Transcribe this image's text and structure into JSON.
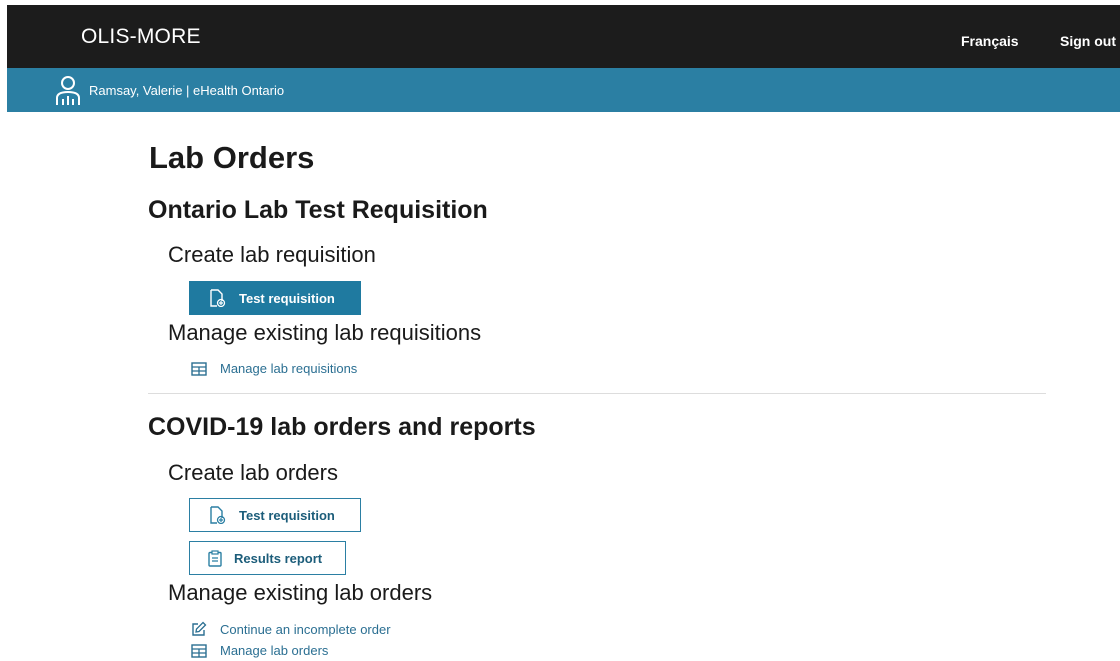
{
  "header": {
    "app_title": "OLIS-MORE",
    "language_link": "Français",
    "signout_link": "Sign out"
  },
  "user_bar": {
    "user_text": "Ramsay, Valerie | eHealth Ontario"
  },
  "page": {
    "title": "Lab Orders"
  },
  "section_ontario": {
    "heading": "Ontario Lab Test Requisition",
    "create_heading": "Create lab requisition",
    "test_requisition_button": "Test requisition",
    "manage_heading": "Manage existing lab requisitions",
    "manage_link": "Manage lab requisitions"
  },
  "section_covid": {
    "heading": "COVID-19 lab orders and reports",
    "create_heading": "Create lab orders",
    "test_requisition_button": "Test requisition",
    "results_report_button": "Results report",
    "manage_heading": "Manage existing lab orders",
    "continue_link": "Continue an incomplete order",
    "manage_link": "Manage lab orders"
  },
  "icons": {
    "user": "user-icon",
    "document_add": "document-add-icon",
    "table": "table-icon",
    "clipboard": "clipboard-icon",
    "edit": "edit-icon"
  },
  "colors": {
    "header_bg": "#1c1c1c",
    "user_bar_bg": "#2b7fa3",
    "primary_button": "#1f7aa0",
    "link": "#2b6f92"
  }
}
